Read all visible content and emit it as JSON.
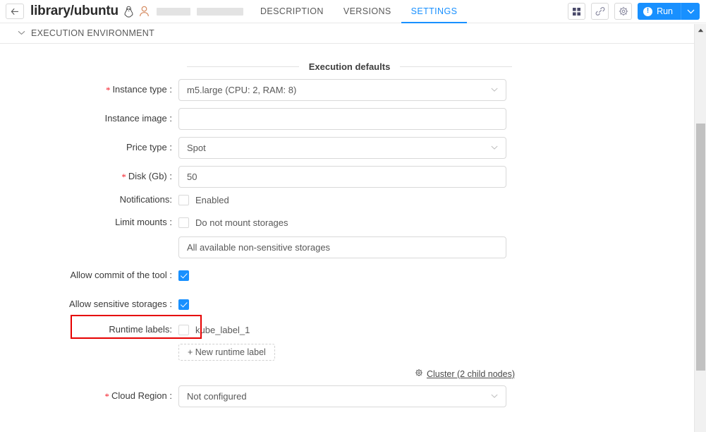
{
  "header": {
    "back_icon": "arrow-left-icon",
    "title": "library/ubuntu",
    "os_icon": "linux-penguin-icon",
    "user_icon": "user-icon",
    "tabs": [
      {
        "label": "DESCRIPTION",
        "active": false
      },
      {
        "label": "VERSIONS",
        "active": false
      },
      {
        "label": "SETTINGS",
        "active": true
      }
    ],
    "buttons": {
      "grid_icon": "grid-apps-icon",
      "link_icon": "link-icon",
      "gear_icon": "gear-icon",
      "run_label": "Run",
      "run_icon": "exclamation-circle-icon",
      "run_caret_icon": "chevron-down-icon"
    },
    "accent_color": "#1890ff"
  },
  "section": {
    "chevron_icon": "chevron-down-icon",
    "title": "EXECUTION ENVIRONMENT"
  },
  "form": {
    "divider_title": "Execution defaults",
    "instance_type": {
      "label": "Instance type",
      "required": true,
      "value": "m5.large (CPU: 2, RAM: 8)",
      "caret_icon": "chevron-down-icon"
    },
    "instance_image": {
      "label": "Instance image",
      "required": false,
      "value": ""
    },
    "price_type": {
      "label": "Price type",
      "required": false,
      "value": "Spot",
      "caret_icon": "chevron-down-icon"
    },
    "disk": {
      "label": "Disk (Gb)",
      "required": true,
      "value": "50"
    },
    "notifications": {
      "label": "Notifications:",
      "checkbox_label": "Enabled",
      "checked": false
    },
    "limit_mounts": {
      "label": "Limit mounts",
      "checkbox_label": "Do not mount storages",
      "checked": false,
      "storages_value": "All available non-sensitive storages"
    },
    "allow_commit": {
      "label": "Allow commit of the tool",
      "checked": true
    },
    "allow_sensitive": {
      "label": "Allow sensitive storages",
      "checked": true,
      "highlight_color": "#e60000"
    },
    "runtime_labels": {
      "label": "Runtime labels:",
      "items": [
        {
          "name": "kube_label_1",
          "checked": false
        }
      ],
      "add_button": "+ New runtime label"
    },
    "cluster_link": {
      "icon": "gear-icon",
      "text": "Cluster (2 child nodes)"
    },
    "cloud_region": {
      "label": "Cloud Region",
      "required": true,
      "value": "Not configured",
      "caret_icon": "chevron-down-icon"
    }
  },
  "scrollbar": {
    "up_arrow_icon": "caret-up-icon",
    "thumb": "vertical-scroll-thumb"
  }
}
